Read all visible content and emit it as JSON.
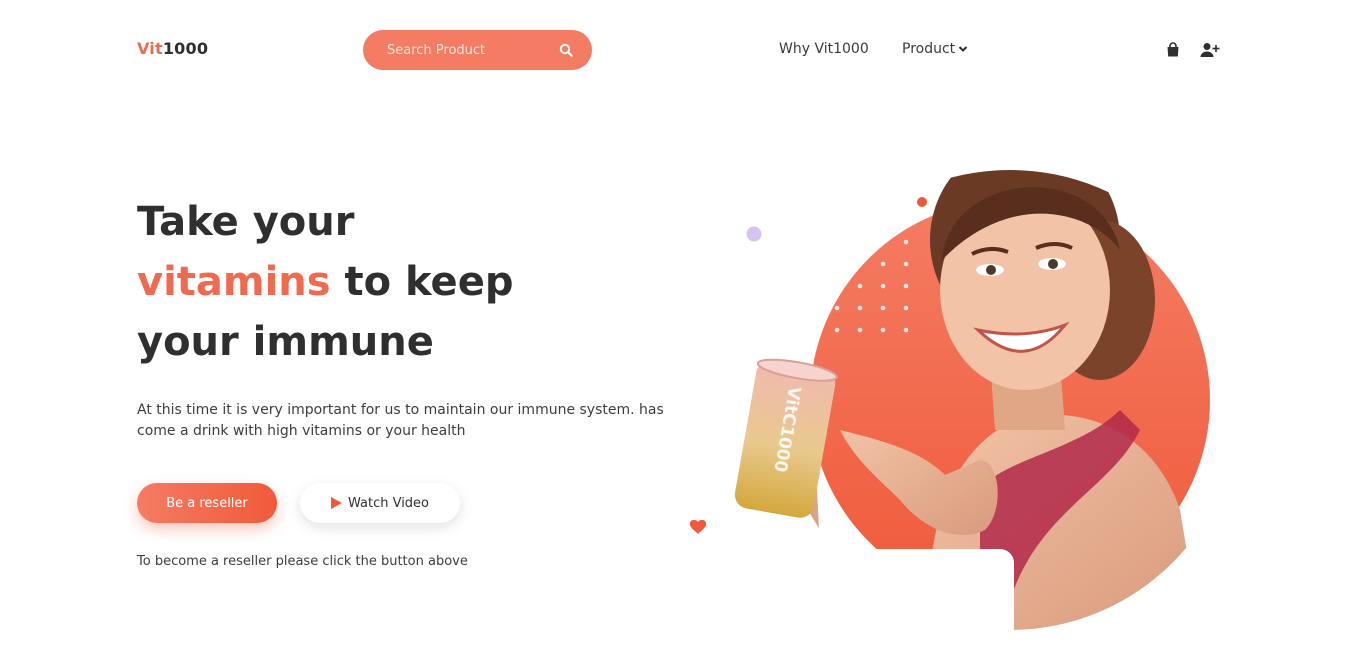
{
  "header": {
    "logo_accent": "Vit",
    "logo_rest": "1000",
    "search": {
      "placeholder": "Search Product",
      "icon": "search-icon"
    },
    "nav": [
      {
        "label": "Why Vit1000"
      },
      {
        "label": "Product",
        "icon": "chevron-down-icon"
      }
    ],
    "icons": [
      "shopping-bag-icon",
      "user-plus-icon"
    ]
  },
  "hero": {
    "headline_line1": "Take your",
    "headline_accent": "vitamins",
    "headline_line2_rest": " to keep",
    "headline_line3": "your immune",
    "subtext": "At this time it is very important for us to maintain our immune system. has come a drink with high vitamins or your health",
    "reseller_button": "Be a reseller",
    "video_button": "Watch Video",
    "note": "To become a reseller please click the button above",
    "can_label": "VitC1000"
  },
  "colors": {
    "accent": "#f06a4f",
    "search_bg": "#f47c63",
    "circle_top": "#f47c63",
    "circle_bottom": "#f05a3a",
    "purple_dot": "#d6c2f5",
    "text_dark": "#2f2f2f"
  }
}
